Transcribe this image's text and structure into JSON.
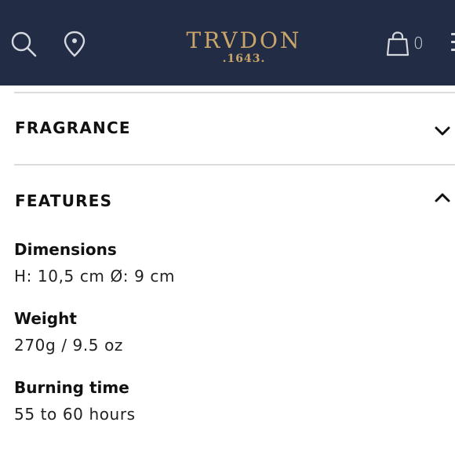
{
  "header": {
    "brand_name": "TRVDON",
    "brand_year": ".1643.",
    "cart_count": "0",
    "icons": [
      "search-icon",
      "location-pin-icon",
      "shopping-bag-icon",
      "menu-icon"
    ],
    "background_color": "#232c45",
    "logo_color": "#c9a56a"
  },
  "accordion": {
    "fragrance": {
      "title": "FRAGRANCE",
      "expanded": false
    },
    "features": {
      "title": "FEATURES",
      "expanded": true,
      "items": [
        {
          "label": "Dimensions",
          "value": "H: 10,5 cm Ø: 9 cm"
        },
        {
          "label": "Weight",
          "value": "270g / 9.5 oz"
        },
        {
          "label": "Burning time",
          "value": "55 to 60 hours"
        }
      ]
    }
  }
}
